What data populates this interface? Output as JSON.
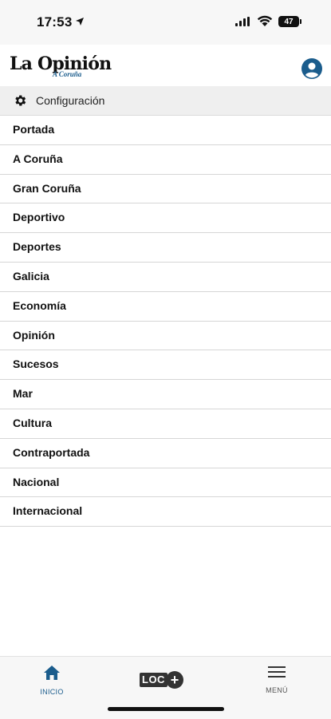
{
  "status_bar": {
    "time": "17:53",
    "battery": "47"
  },
  "header": {
    "logo_main": "La Opinión",
    "logo_sub": "A Coruña",
    "account_icon": "user-circle-icon"
  },
  "config": {
    "label": "Configuración",
    "icon": "gear-icon"
  },
  "menu_items": [
    "Portada",
    "A Coruña",
    "Gran Coruña",
    "Deportivo",
    "Deportes",
    "Galicia",
    "Economía",
    "Opinión",
    "Sucesos",
    "Mar",
    "Cultura",
    "Contraportada",
    "Nacional",
    "Internacional"
  ],
  "tabbar": {
    "home_label": "INICIO",
    "loc_text": "LOC",
    "loc_plus": "+",
    "menu_label": "MENÚ"
  },
  "colors": {
    "accent": "#1a5c8c",
    "text": "#111111",
    "config_bg": "#efefef",
    "tabbar_bg": "#f7f7f7"
  }
}
